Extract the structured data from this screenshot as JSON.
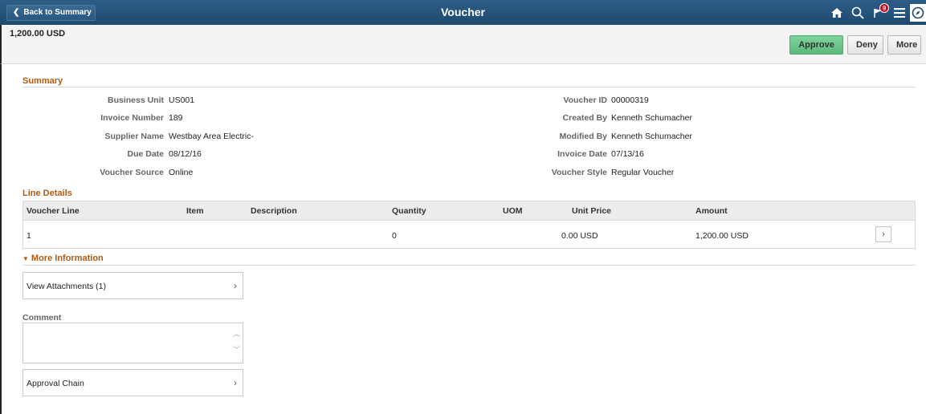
{
  "header": {
    "back_label": "Back to Summary",
    "title": "Voucher",
    "notification_count": "9",
    "icons": [
      "home-icon",
      "search-icon",
      "flag-icon",
      "menu-icon",
      "compass-icon"
    ]
  },
  "band": {
    "amount": "1,200.00  USD",
    "approve_label": "Approve",
    "deny_label": "Deny",
    "more_label": "More",
    "approve_color": "#6cc58c"
  },
  "summary": {
    "title": "Summary",
    "left": [
      {
        "label": "Business Unit",
        "value": "US001"
      },
      {
        "label": "Invoice Number",
        "value": "189"
      },
      {
        "label": "Supplier Name",
        "value": "Westbay Area Electric-"
      },
      {
        "label": "Due Date",
        "value": "08/12/16"
      },
      {
        "label": "Voucher Source",
        "value": "Online"
      }
    ],
    "right": [
      {
        "label": "Voucher ID",
        "value": "00000319"
      },
      {
        "label": "Created By",
        "value": "Kenneth Schumacher"
      },
      {
        "label": "Modified By",
        "value": "Kenneth Schumacher"
      },
      {
        "label": "Invoice Date",
        "value": "07/13/16"
      },
      {
        "label": "Voucher Style",
        "value": "Regular Voucher"
      }
    ]
  },
  "line_details": {
    "title": "Line Details",
    "columns": [
      "Voucher Line",
      "Item",
      "Description",
      "Quantity",
      "UOM",
      "Unit Price",
      "Amount"
    ],
    "rows": [
      [
        "1",
        "",
        "",
        "0",
        "",
        "0.00 USD",
        "1,200.00 USD"
      ]
    ]
  },
  "more_information": {
    "label": "More Information",
    "view_attachments": "View Attachments (1)",
    "comment_label": "Comment",
    "comment_value": "",
    "approval_chain": "Approval Chain"
  },
  "colors": {
    "header_bg": "#2a5a83",
    "section_title": "#b05a12"
  }
}
